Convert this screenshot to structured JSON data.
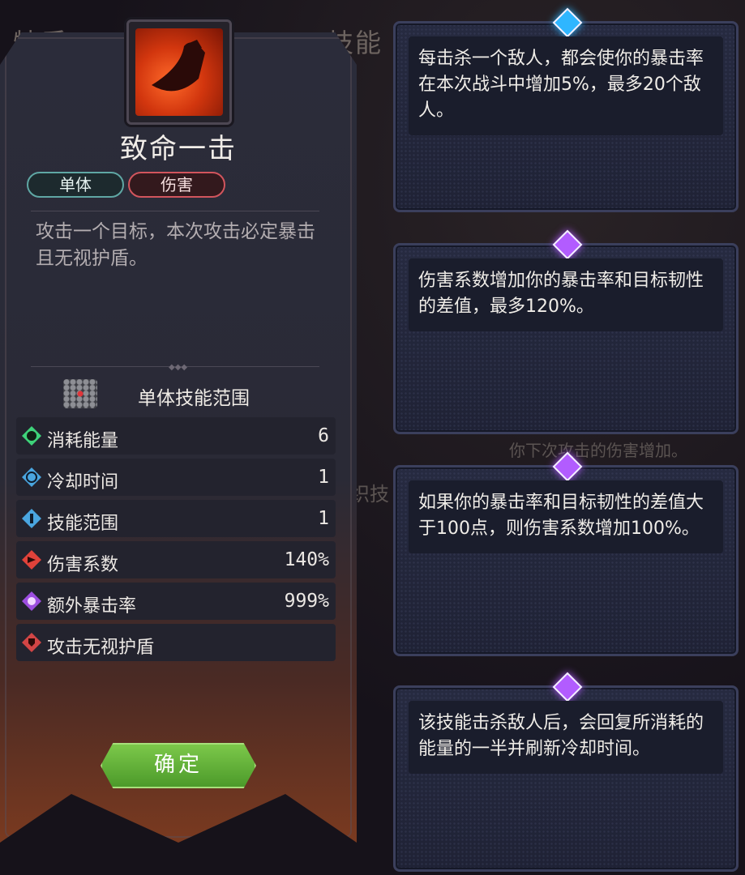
{
  "background": {
    "tab_left": "特质",
    "tab_mid": "技能",
    "hint_text": "你下次攻击的伤害增加。",
    "side_text": "织技"
  },
  "skill": {
    "name": "致命一击",
    "tags": [
      "单体",
      "伤害"
    ],
    "description": "攻击一个目标，本次攻击必定暴击且无视护盾。",
    "range_label": "单体技能范围",
    "confirm_label": "确定",
    "stats": [
      {
        "icon": "energy-icon",
        "label": "消耗能量",
        "value": "6",
        "color": "#3ed37a"
      },
      {
        "icon": "cooldown-icon",
        "label": "冷却时间",
        "value": "1",
        "color": "#4aa6e0"
      },
      {
        "icon": "range-icon",
        "label": "技能范围",
        "value": "1",
        "color": "#4aa6e0"
      },
      {
        "icon": "damage-icon",
        "label": "伤害系数",
        "value": "140%",
        "color": "#e0423a"
      },
      {
        "icon": "crit-icon",
        "label": "额外暴击率",
        "value": "999%",
        "color": "#9d4ee0"
      },
      {
        "icon": "shield-pierce-icon",
        "label": "攻击无视护盾",
        "value": "",
        "color": "#d24545"
      }
    ]
  },
  "upgrades": [
    {
      "gem": "blue",
      "text": "每击杀一个敌人，都会使你的暴击率在本次战斗中增加5%，最多20个敌人。"
    },
    {
      "gem": "purple",
      "text": "伤害系数增加你的暴击率和目标韧性的差值，最多120%。"
    },
    {
      "gem": "purple",
      "text": "如果你的暴击率和目标韧性的差值大于100点，则伤害系数增加100%。"
    },
    {
      "gem": "purple",
      "text": "该技能击杀敌人后，会回复所消耗的能量的一半并刷新冷却时间。"
    }
  ],
  "colors": {
    "confirm_green": "#5aae35",
    "tag_single": "#5fa7a4",
    "tag_damage": "#d2555d"
  }
}
